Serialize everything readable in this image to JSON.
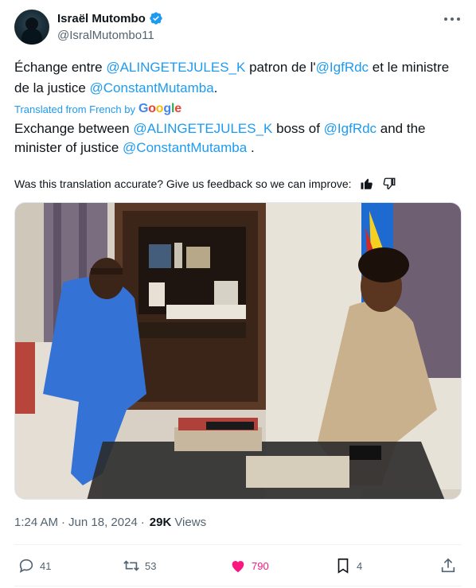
{
  "author": {
    "name": "Israël Mutombo",
    "handle": "@IsralMutombo11"
  },
  "tweet": {
    "text_before": "Échange entre ",
    "mention1": "@ALINGETEJULES_K",
    "text_mid1": " patron de l'",
    "mention2": "@IgfRdc",
    "text_mid2": " et le ministre de la justice ",
    "mention3": "@ConstantMutamba",
    "text_end": "."
  },
  "translation": {
    "label": "Translated from French by",
    "provider": "Google",
    "text_before": "Exchange between ",
    "mention1": "@ALINGETEJULES_K",
    "text_mid1": " boss of ",
    "mention2": "@IgfRdc",
    "text_mid2": " and the minister of justice ",
    "mention3": "@ConstantMutamba",
    "text_end": " ."
  },
  "feedback": {
    "prompt": "Was this translation accurate? Give us feedback so we can improve:"
  },
  "meta": {
    "time": "1:24 AM",
    "separator": "·",
    "date": "Jun 18, 2024",
    "views_count": "29K",
    "views_label": "Views"
  },
  "actions": {
    "replies": "41",
    "reposts": "53",
    "likes": "790",
    "bookmarks": "4"
  },
  "colors": {
    "link": "#1d9bf0",
    "like": "#f91880",
    "secondary_text": "#536471"
  }
}
